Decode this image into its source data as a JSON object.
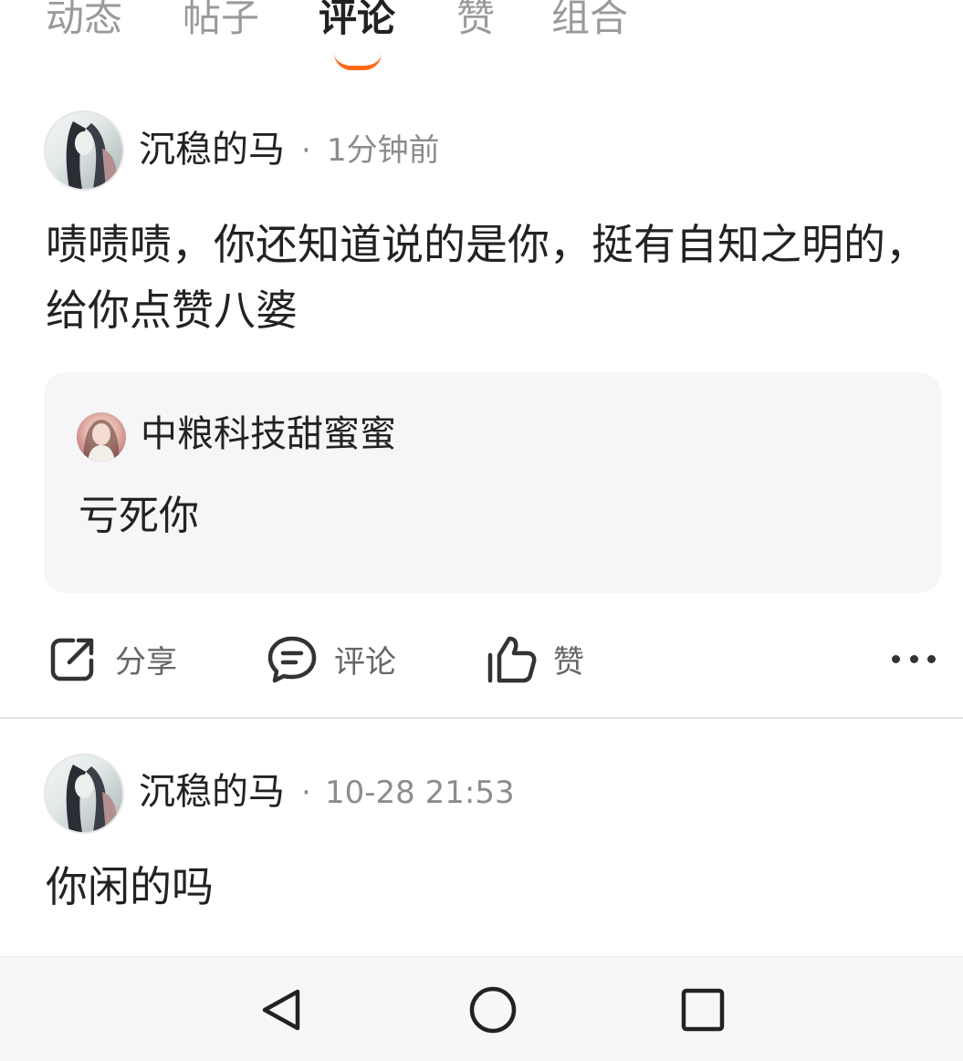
{
  "tabs": [
    {
      "label": "动态",
      "active": false
    },
    {
      "label": "帖子",
      "active": false
    },
    {
      "label": "评论",
      "active": true
    },
    {
      "label": "赞",
      "active": false
    },
    {
      "label": "组合",
      "active": false
    }
  ],
  "accent_color": "#ff6a1a",
  "posts": [
    {
      "author": "沉稳的马",
      "separator": "·",
      "time": "1分钟前",
      "content": "啧啧啧，你还知道说的是你，挺有自知之明的，给你点赞八婆",
      "quote": {
        "author": "中粮科技甜蜜蜜",
        "content": "亏死你"
      }
    },
    {
      "author": "沉稳的马",
      "separator": "·",
      "time": "10-28 21:53",
      "content": "你闲的吗"
    }
  ],
  "actions": {
    "share_label": "分享",
    "comment_label": "评论",
    "like_label": "赞"
  },
  "icons": {
    "share": "share-icon",
    "comment": "comment-icon",
    "like": "thumbs-up-icon",
    "more": "more-dots-icon",
    "back": "back-triangle-icon",
    "home": "home-circle-icon",
    "recents": "recents-square-icon"
  }
}
